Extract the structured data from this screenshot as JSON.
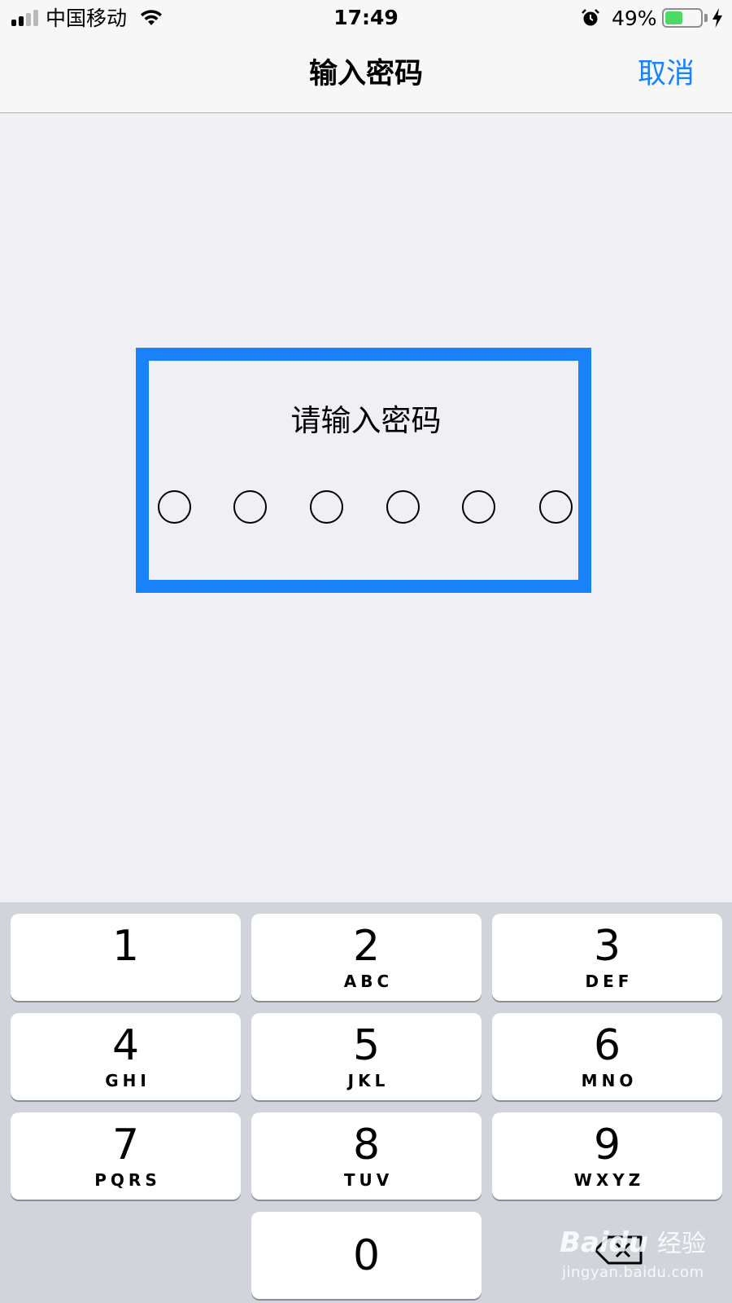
{
  "status_bar": {
    "carrier": "中国移动",
    "time": "17:49",
    "battery_percent_label": "49%",
    "battery_level": 0.49,
    "signal_bars_filled": 2,
    "signal_bars_total": 4,
    "icons": [
      "signal-icon",
      "wifi-icon",
      "alarm-icon",
      "battery-icon",
      "charging-icon"
    ]
  },
  "nav": {
    "title": "输入密码",
    "cancel_label": "取消"
  },
  "passcode": {
    "prompt": "请输入密码",
    "digits_total": 6,
    "digits_entered": 0
  },
  "keypad": {
    "keys": [
      {
        "digit": "1",
        "letters": ""
      },
      {
        "digit": "2",
        "letters": "ABC"
      },
      {
        "digit": "3",
        "letters": "DEF"
      },
      {
        "digit": "4",
        "letters": "GHI"
      },
      {
        "digit": "5",
        "letters": "JKL"
      },
      {
        "digit": "6",
        "letters": "MNO"
      },
      {
        "digit": "7",
        "letters": "PQRS"
      },
      {
        "digit": "8",
        "letters": "TUV"
      },
      {
        "digit": "9",
        "letters": "WXYZ"
      },
      {
        "digit": "0",
        "letters": ""
      }
    ],
    "delete_icon": "delete-icon"
  },
  "watermark": {
    "brand": "Baidu",
    "suffix": "经验",
    "url": "jingyan.baidu.com"
  },
  "colors": {
    "accent": "#1a82fb",
    "background": "#efeff4",
    "keypad_background": "#d1d5db",
    "battery_fill": "#4cd964"
  }
}
